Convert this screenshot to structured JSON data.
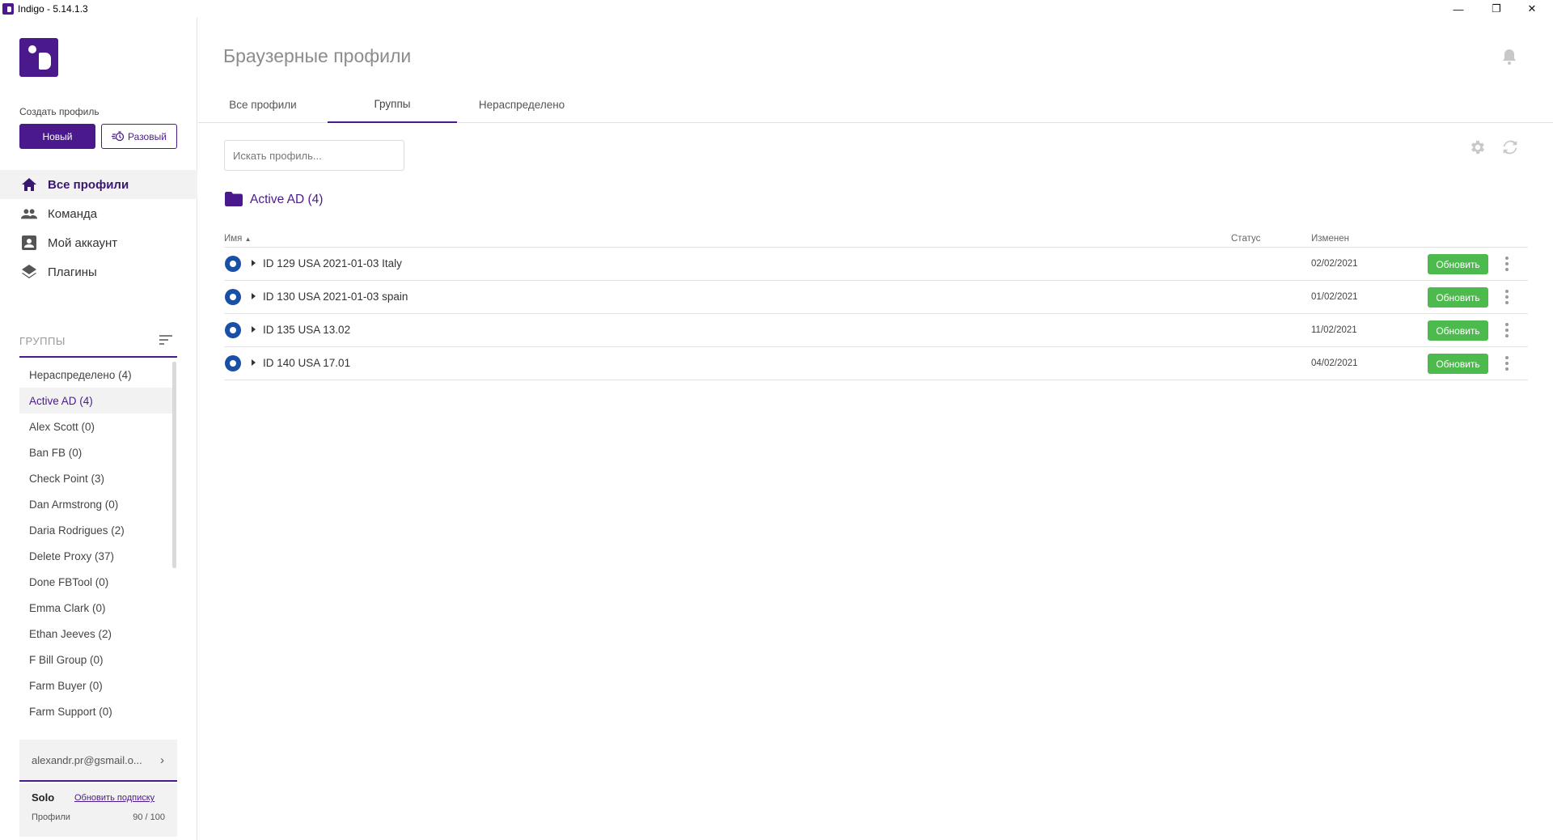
{
  "window": {
    "title": "Indigo - 5.14.1.3",
    "minimize": "—",
    "restore": "❐",
    "close": "✕"
  },
  "sidebar": {
    "create_label": "Создать профиль",
    "new_button": "Новый",
    "once_button": "Разовый",
    "nav": [
      {
        "label": "Все профили",
        "icon": "home-icon"
      },
      {
        "label": "Команда",
        "icon": "team-icon"
      },
      {
        "label": "Мой аккаунт",
        "icon": "account-icon"
      },
      {
        "label": "Плагины",
        "icon": "layers-icon"
      }
    ],
    "groups_label": "ГРУППЫ",
    "groups": [
      "Нераспределено  (4)",
      "Active AD  (4)",
      "Alex Scott  (0)",
      "Ban FB  (0)",
      "Check Point  (3)",
      "Dan Armstrong  (0)",
      "Daria Rodrigues  (2)",
      "Delete Proxy  (37)",
      "Done FBTool  (0)",
      "Emma Clark  (0)",
      "Ethan Jeeves  (2)",
      "F Bill Group  (0)",
      "Farm Buyer  (0)",
      "Farm Support  (0)"
    ],
    "active_group_index": 1,
    "account_email": "alexandr.pr@gsmail.o...",
    "plan": "Solo",
    "upgrade_link": "Обновить подписку",
    "profiles_label": "Профили",
    "profiles_count": "90 / 100"
  },
  "main": {
    "title": "Браузерные профили",
    "tabs": [
      "Все профили",
      "Группы",
      "Нераспределено"
    ],
    "active_tab": 1,
    "search_placeholder": "Искать профиль...",
    "group_title": "Active AD (4)",
    "columns": {
      "name": "Имя",
      "status": "Статус",
      "modified": "Изменен"
    },
    "rows": [
      {
        "name": "ID 129 USA 2021-01-03 Italy",
        "status": "",
        "modified": "02/02/2021",
        "action": "Обновить"
      },
      {
        "name": "ID 130 USA 2021-01-03 spain",
        "status": "",
        "modified": "01/02/2021",
        "action": "Обновить"
      },
      {
        "name": "ID 135 USA 13.02",
        "status": "",
        "modified": "11/02/2021",
        "action": "Обновить"
      },
      {
        "name": "ID 140 USA 17.01",
        "status": "",
        "modified": "04/02/2021",
        "action": "Обновить"
      }
    ]
  },
  "colors": {
    "brand": "#4a1a8c",
    "update_button": "#4cba4c",
    "radio": "#1a4fa8"
  }
}
